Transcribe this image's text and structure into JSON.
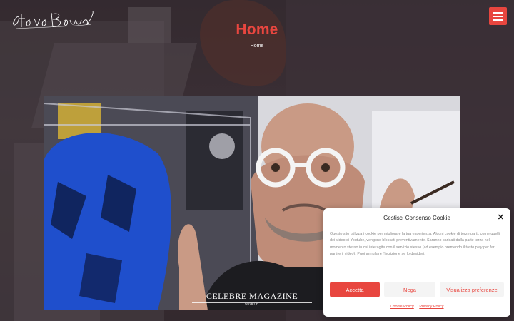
{
  "header": {
    "logo_text": "Steve Bauer",
    "menu_icon": "hamburger-menu-icon"
  },
  "hero": {
    "title": "Home",
    "breadcrumb": "Home"
  },
  "feature_image": {
    "magazine_name": "CELEBRE MAGAZINE",
    "magazine_sub": "WORLD"
  },
  "cookie_banner": {
    "title": "Gestisci Consenso Cookie",
    "text": "Questo sito utilizza i cookie per migliorare la tua esperienza. Alcuni cookie di terze parti, come quelli dei video di Youtube, vengono bloccati preventivamente. Saranno caricati dalla parte terza nel momento stesso in cui interagite con il servizio stesso (ad esempio premendo il tasto play per far partire il video). Puoi annullare l'iscrizione se lo desideri.",
    "accept_label": "Accetta",
    "deny_label": "Nega",
    "preferences_label": "Visualizza preferenze",
    "cookie_policy_link": "Cookie Policy",
    "privacy_policy_link": "Privacy Policy",
    "close_icon": "close-icon"
  },
  "colors": {
    "accent": "#e8463f",
    "background": "#3b3236",
    "banner_bg": "#ffffff"
  }
}
